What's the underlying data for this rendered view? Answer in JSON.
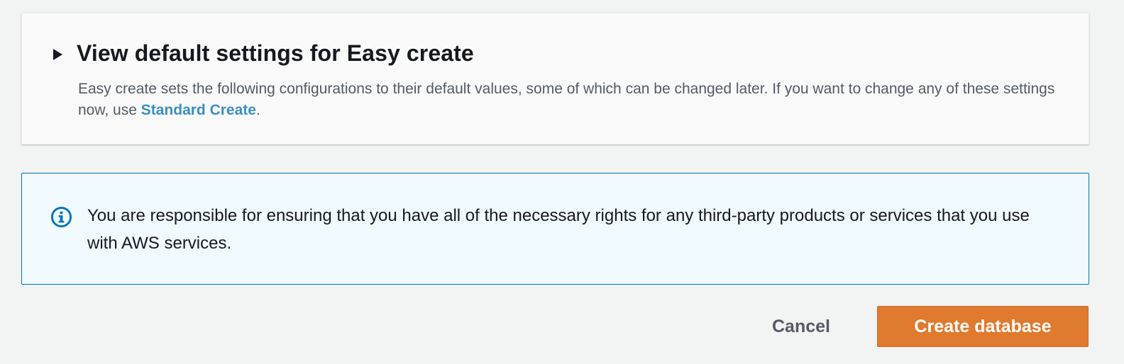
{
  "panel": {
    "title": "View default settings for Easy create",
    "description_before": "Easy create sets the following configurations to their default values, some of which can be changed later. If you want to change any of these settings now, use ",
    "link_label": "Standard Create",
    "description_after": "."
  },
  "alert": {
    "icon": "info-icon",
    "text": "You are responsible for ensuring that you have all of the necessary rights for any third-party products or services that you use with AWS services."
  },
  "actions": {
    "cancel_label": "Cancel",
    "create_label": "Create database"
  },
  "colors": {
    "link": "#3a8fc4",
    "primary_button": "#e07a2e",
    "alert_border": "#0073bb",
    "alert_background": "#f1faff"
  }
}
